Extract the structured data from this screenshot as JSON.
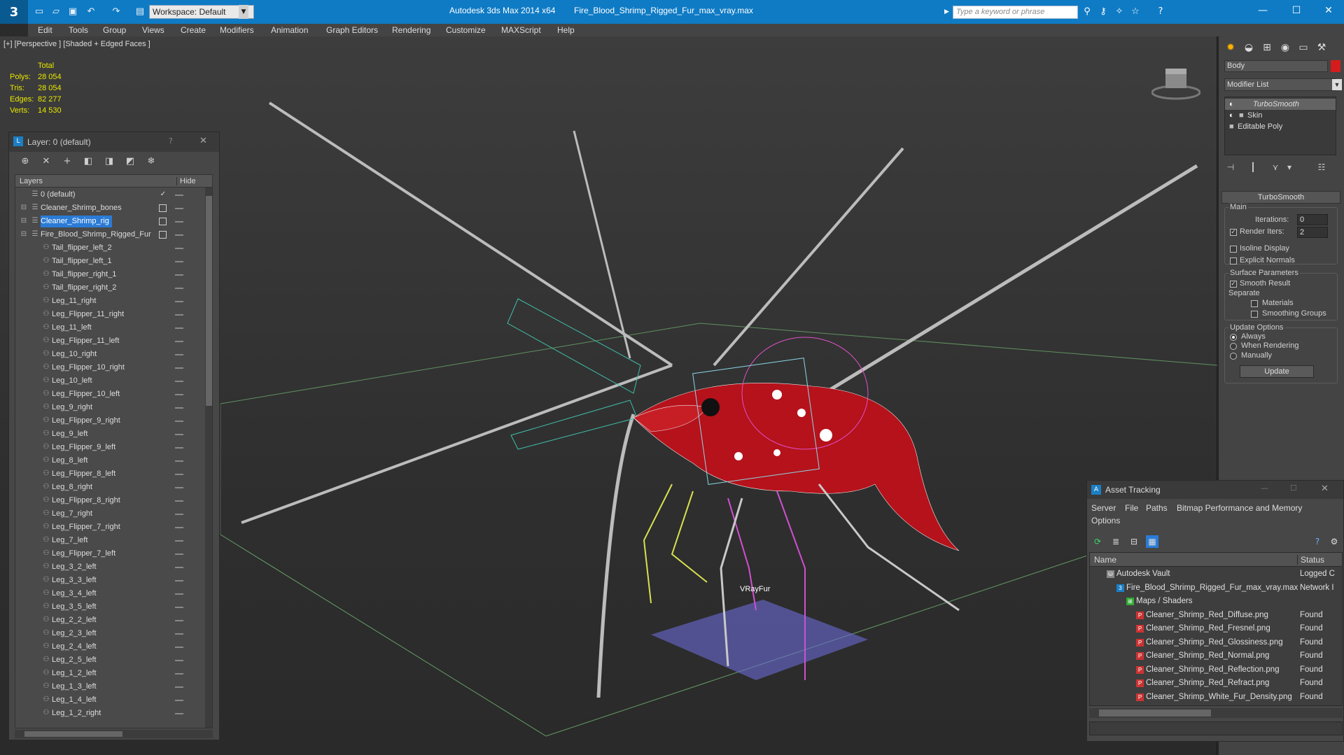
{
  "titlebar": {
    "workspace": "Workspace: Default",
    "app_title": "Autodesk 3ds Max  2014 x64",
    "file_title": "Fire_Blood_Shrimp_Rigged_Fur_max_vray.max",
    "search_placeholder": "Type a keyword or phrase"
  },
  "menu": [
    "Edit",
    "Tools",
    "Group",
    "Views",
    "Create",
    "Modifiers",
    "Animation",
    "Graph Editors",
    "Rendering",
    "Customize",
    "MAXScript",
    "Help"
  ],
  "viewport": {
    "label": "[+] [Perspective ] [Shaded + Edged Faces ]",
    "stats_header": "Total",
    "stats": [
      {
        "label": "Polys:",
        "value": "28 054"
      },
      {
        "label": "Tris:",
        "value": "28 054"
      },
      {
        "label": "Edges:",
        "value": "82 277"
      },
      {
        "label": "Verts:",
        "value": "14 530"
      }
    ],
    "fur_label": "VRayFur"
  },
  "layer_panel": {
    "title": "Layer: 0 (default)",
    "help": "?",
    "col_layers": "Layers",
    "col_hide": "Hide",
    "rows": [
      {
        "name": "0 (default)",
        "indent": 1,
        "check": true
      },
      {
        "name": "Cleaner_Shrimp_bones",
        "indent": 1,
        "box": true
      },
      {
        "name": "Cleaner_Shrimp_rig",
        "indent": 1,
        "box": true,
        "selected": true
      },
      {
        "name": "Fire_Blood_Shrimp_Rigged_Fur",
        "indent": 1,
        "box": true
      },
      {
        "name": "Tail_flipper_left_2",
        "indent": 2
      },
      {
        "name": "Tail_flipper_left_1",
        "indent": 2
      },
      {
        "name": "Tail_flipper_right_1",
        "indent": 2
      },
      {
        "name": "Tail_flipper_right_2",
        "indent": 2
      },
      {
        "name": "Leg_11_right",
        "indent": 2
      },
      {
        "name": "Leg_Flipper_11_right",
        "indent": 2
      },
      {
        "name": "Leg_11_left",
        "indent": 2
      },
      {
        "name": "Leg_Flipper_11_left",
        "indent": 2
      },
      {
        "name": "Leg_10_right",
        "indent": 2
      },
      {
        "name": "Leg_Flipper_10_right",
        "indent": 2
      },
      {
        "name": "Leg_10_left",
        "indent": 2
      },
      {
        "name": "Leg_Flipper_10_left",
        "indent": 2
      },
      {
        "name": "Leg_9_right",
        "indent": 2
      },
      {
        "name": "Leg_Flipper_9_right",
        "indent": 2
      },
      {
        "name": "Leg_9_left",
        "indent": 2
      },
      {
        "name": "Leg_Flipper_9_left",
        "indent": 2
      },
      {
        "name": "Leg_8_left",
        "indent": 2
      },
      {
        "name": "Leg_Flipper_8_left",
        "indent": 2
      },
      {
        "name": "Leg_8_right",
        "indent": 2
      },
      {
        "name": "Leg_Flipper_8_right",
        "indent": 2
      },
      {
        "name": "Leg_7_right",
        "indent": 2
      },
      {
        "name": "Leg_Flipper_7_right",
        "indent": 2
      },
      {
        "name": "Leg_7_left",
        "indent": 2
      },
      {
        "name": "Leg_Flipper_7_left",
        "indent": 2
      },
      {
        "name": "Leg_3_2_left",
        "indent": 2
      },
      {
        "name": "Leg_3_3_left",
        "indent": 2
      },
      {
        "name": "Leg_3_4_left",
        "indent": 2
      },
      {
        "name": "Leg_3_5_left",
        "indent": 2
      },
      {
        "name": "Leg_2_2_left",
        "indent": 2
      },
      {
        "name": "Leg_2_3_left",
        "indent": 2
      },
      {
        "name": "Leg_2_4_left",
        "indent": 2
      },
      {
        "name": "Leg_2_5_left",
        "indent": 2
      },
      {
        "name": "Leg_1_2_left",
        "indent": 2
      },
      {
        "name": "Leg_1_3_left",
        "indent": 2
      },
      {
        "name": "Leg_1_4_left",
        "indent": 2
      },
      {
        "name": "Leg_1_2_right",
        "indent": 2
      }
    ]
  },
  "command_panel": {
    "object_name": "Body",
    "object_color": "#d41c1c",
    "modifier_list": "Modifier List",
    "stack": [
      "TurboSmooth",
      "Skin",
      "Editable Poly"
    ],
    "rollout": "TurboSmooth",
    "main_label": "Main",
    "iterations_label": "Iterations:",
    "iterations_value": "0",
    "render_iters_label": "Render Iters:",
    "render_iters_value": "2",
    "isoline": "Isoline Display",
    "explicit_normals": "Explicit Normals",
    "surface_params": "Surface Parameters",
    "smooth_result": "Smooth Result",
    "separate": "Separate",
    "materials": "Materials",
    "smoothing_groups": "Smoothing Groups",
    "update_options": "Update Options",
    "always": "Always",
    "when_rendering": "When Rendering",
    "manually": "Manually",
    "update_button": "Update"
  },
  "asset_tracking": {
    "title": "Asset Tracking",
    "menu": [
      "Server",
      "File",
      "Paths",
      "Bitmap Performance and Memory"
    ],
    "menu2": "Options",
    "col_name": "Name",
    "col_status": "Status",
    "rows": [
      {
        "name": "Autodesk Vault",
        "status": "Logged C",
        "indent": 0,
        "icon": "vault"
      },
      {
        "name": "Fire_Blood_Shrimp_Rigged_Fur_max_vray.max",
        "status": "Network I",
        "indent": 1,
        "icon": "max"
      },
      {
        "name": "Maps / Shaders",
        "status": "",
        "indent": 2,
        "icon": "maps"
      },
      {
        "name": "Cleaner_Shrimp_Red_Diffuse.png",
        "status": "Found",
        "indent": 3,
        "icon": "png"
      },
      {
        "name": "Cleaner_Shrimp_Red_Fresnel.png",
        "status": "Found",
        "indent": 3,
        "icon": "png"
      },
      {
        "name": "Cleaner_Shrimp_Red_Glossiness.png",
        "status": "Found",
        "indent": 3,
        "icon": "png"
      },
      {
        "name": "Cleaner_Shrimp_Red_Normal.png",
        "status": "Found",
        "indent": 3,
        "icon": "png"
      },
      {
        "name": "Cleaner_Shrimp_Red_Reflection.png",
        "status": "Found",
        "indent": 3,
        "icon": "png"
      },
      {
        "name": "Cleaner_Shrimp_Red_Refract.png",
        "status": "Found",
        "indent": 3,
        "icon": "png"
      },
      {
        "name": "Cleaner_Shrimp_White_Fur_Density.png",
        "status": "Found",
        "indent": 3,
        "icon": "png"
      }
    ]
  }
}
